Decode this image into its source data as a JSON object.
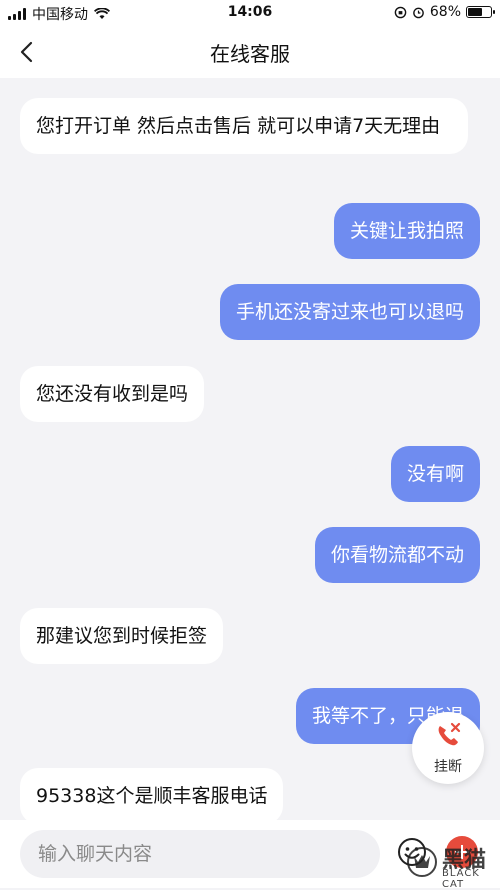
{
  "status_bar": {
    "carrier": "中国移动",
    "time": "14:06",
    "battery_percent": "68%",
    "battery_level": 0.68,
    "icons": [
      "signal-icon",
      "wifi-icon",
      "lock-rotation-icon",
      "alarm-icon",
      "battery-icon"
    ]
  },
  "header": {
    "title": "在线客服",
    "back_icon": "chevron-left-icon"
  },
  "messages": [
    {
      "side": "in",
      "text": "您打开订单 然后点击售后 就可以申请7天无理由"
    },
    {
      "side": "out",
      "text": "关键让我拍照"
    },
    {
      "side": "out",
      "text": "手机还没寄过来也可以退吗"
    },
    {
      "side": "in",
      "text": "您还没有收到是吗"
    },
    {
      "side": "out",
      "text": "没有啊"
    },
    {
      "side": "out",
      "text": "你看物流都不动"
    },
    {
      "side": "in",
      "text": "那建议您到时候拒签"
    },
    {
      "side": "out",
      "text": "我等不了，只能退"
    },
    {
      "side": "in",
      "text": "95338这个是顺丰客服电话"
    }
  ],
  "hangup": {
    "label": "挂断",
    "icon": "phone-hangup-icon",
    "accent": "#e64b3c"
  },
  "input_bar": {
    "placeholder": "输入聊天内容",
    "emoji_icon": "emoji-icon",
    "plus_icon": "plus-icon"
  },
  "watermark": {
    "text": "黑猫",
    "sub": "BLACK CAT"
  },
  "colors": {
    "outgoing_bubble": "#6f8cf0",
    "incoming_bubble": "#ffffff",
    "background": "#f3f3f6"
  }
}
